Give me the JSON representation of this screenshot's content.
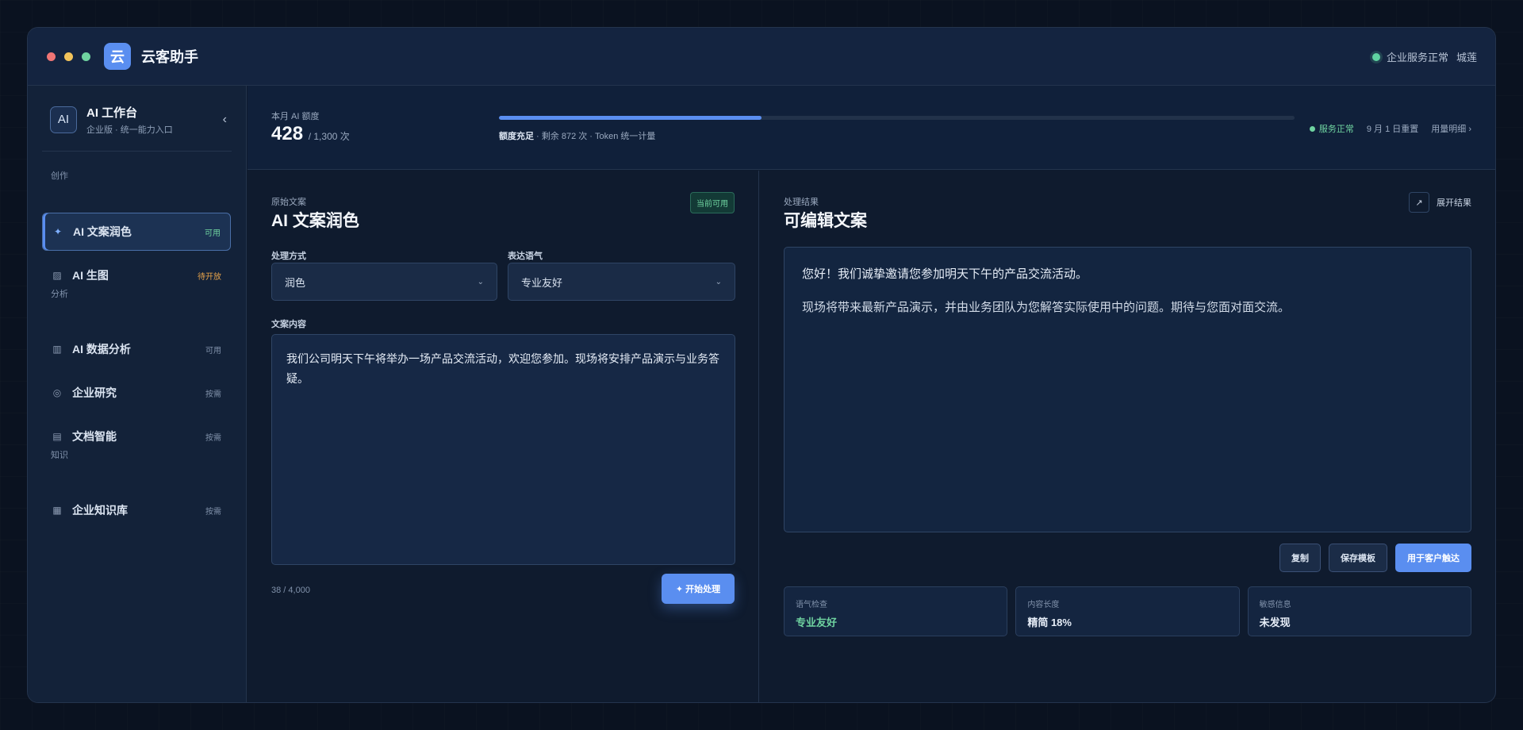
{
  "app": {
    "logo_char": "云",
    "name": "云客助手"
  },
  "titlebar": {
    "status": "企业服务正常",
    "user": "城莲"
  },
  "workspace": {
    "badge": "AI",
    "title": "AI 工作台",
    "subtitle": "企业版 · 统一能力入口",
    "collapse_icon": "‹"
  },
  "sidebar": {
    "sections": [
      "创作",
      "分析",
      "知识"
    ],
    "items": [
      {
        "icon": "✦",
        "label": "AI 文案润色",
        "tag": "可用"
      },
      {
        "icon": "▨",
        "label": "AI 生图",
        "tag": "待开放"
      },
      {
        "icon": "▥",
        "label": "AI 数据分析",
        "tag": "可用"
      },
      {
        "icon": "◎",
        "label": "企业研究",
        "tag": "按需"
      },
      {
        "icon": "▤",
        "label": "文档智能",
        "tag": "按需"
      },
      {
        "icon": "▦",
        "label": "企业知识库",
        "tag": "按需"
      }
    ]
  },
  "quota": {
    "label": "本月 AI 额度",
    "used": "428",
    "total": "/ 1,300 次",
    "progress": 0.33,
    "note_bold": "额度充足",
    "note_rest": " · 剩余 872 次 · Token 统一计量",
    "status": "服务正常",
    "reset": "9 月 1 日重置",
    "details": "用量明细 ›"
  },
  "editor": {
    "caption": "原始文案",
    "title": "AI 文案润色",
    "badge": "当前可用",
    "mode_label": "处理方式",
    "mode_value": "润色",
    "tone_label": "表达语气",
    "tone_value": "专业友好",
    "content_label": "文案内容",
    "content": "我们公司明天下午将举办一场产品交流活动，欢迎您参加。现场将安排产品演示与业务答疑。",
    "counter": "38 / 4,000",
    "start_button": "✦ 开始处理"
  },
  "result": {
    "caption": "处理结果",
    "title": "可编辑文案",
    "expand_icon": "↗",
    "expand_label": "展开结果",
    "paragraph_1": "您好！我们诚挚邀请您参加明天下午的产品交流活动。",
    "paragraph_2": "现场将带来最新产品演示，并由业务团队为您解答实际使用中的问题。期待与您面对面交流。",
    "copy_button": "复制",
    "save_button": "保存模板",
    "use_button": "用于客户触达",
    "stats": [
      {
        "label": "语气检查",
        "value": "专业友好"
      },
      {
        "label": "内容长度",
        "value": "精简 18%"
      },
      {
        "label": "敏感信息",
        "value": "未发现"
      }
    ]
  },
  "colors": {
    "accent": "#5a8ef0",
    "success": "#6fd3a0",
    "warning": "#e6a24a",
    "background": "#0f1b2e"
  }
}
